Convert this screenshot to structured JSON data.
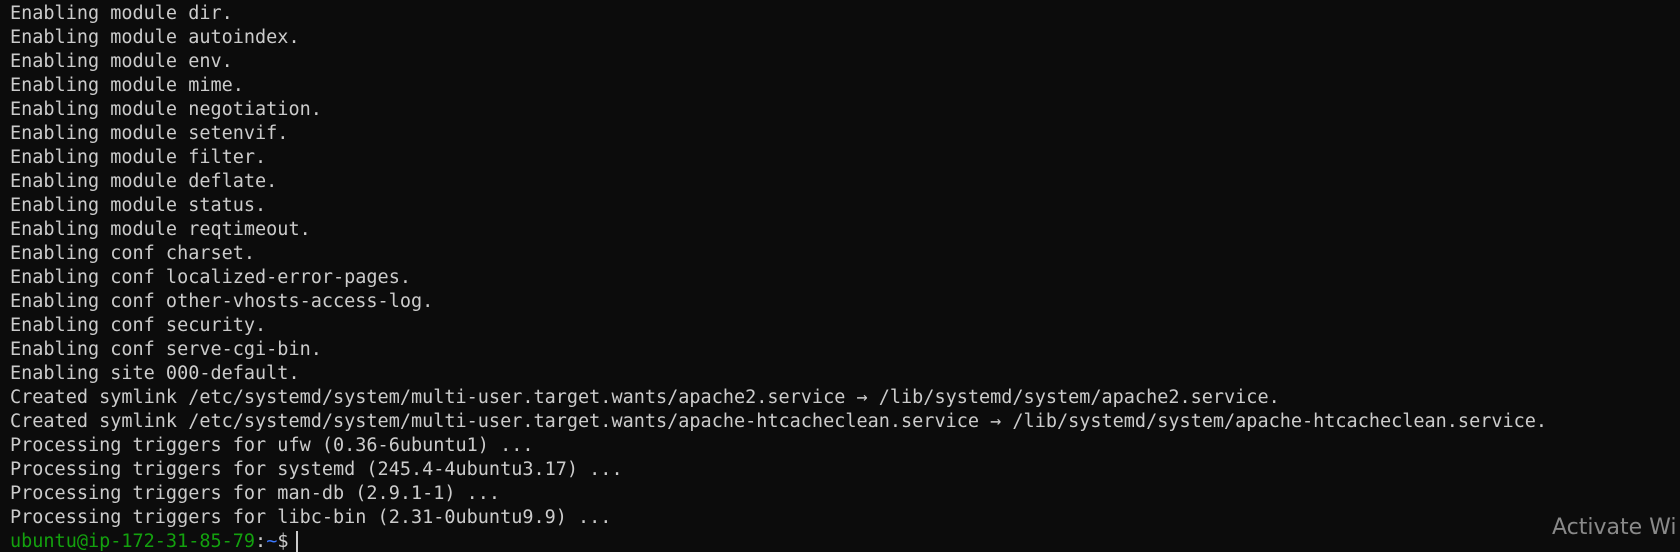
{
  "terminal": {
    "lines": [
      "Enabling module dir.",
      "Enabling module autoindex.",
      "Enabling module env.",
      "Enabling module mime.",
      "Enabling module negotiation.",
      "Enabling module setenvif.",
      "Enabling module filter.",
      "Enabling module deflate.",
      "Enabling module status.",
      "Enabling module reqtimeout.",
      "Enabling conf charset.",
      "Enabling conf localized-error-pages.",
      "Enabling conf other-vhosts-access-log.",
      "Enabling conf security.",
      "Enabling conf serve-cgi-bin.",
      "Enabling site 000-default.",
      "Created symlink /etc/systemd/system/multi-user.target.wants/apache2.service → /lib/systemd/system/apache2.service.",
      "Created symlink /etc/systemd/system/multi-user.target.wants/apache-htcacheclean.service → /lib/systemd/system/apache-htcacheclean.service.",
      "Processing triggers for ufw (0.36-6ubuntu1) ...",
      "Processing triggers for systemd (245.4-4ubuntu3.17) ...",
      "Processing triggers for man-db (2.9.1-1) ...",
      "Processing triggers for libc-bin (2.31-0ubuntu9.9) ..."
    ],
    "prompt": {
      "user_host": "ubuntu@ip-172-31-85-79",
      "separator": ":",
      "path": "~",
      "symbol": "$"
    }
  },
  "watermark": {
    "text": "Activate Wi"
  },
  "colors": {
    "background": "#0c0c0c",
    "text": "#cccccc",
    "prompt_user": "#13a10e",
    "prompt_path": "#3b78ff"
  }
}
